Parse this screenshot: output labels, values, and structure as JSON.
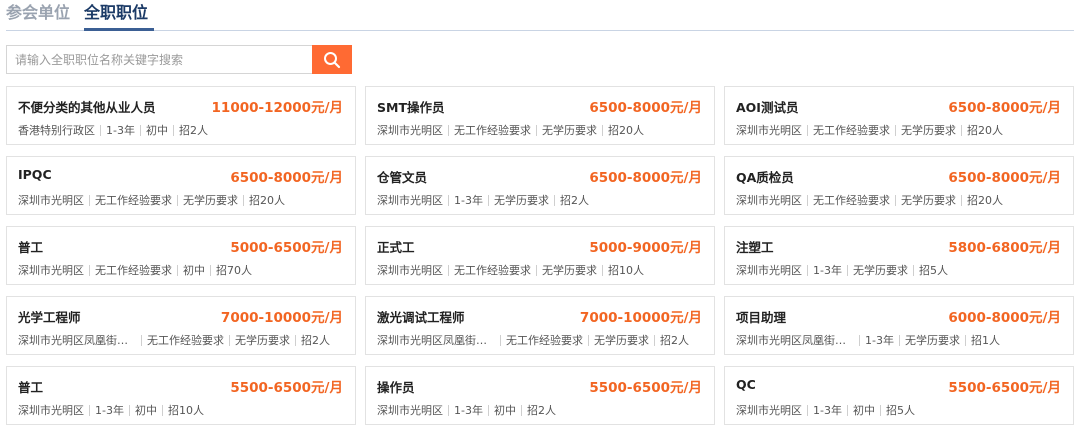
{
  "tabs": {
    "inactive": "参会单位",
    "active": "全职职位"
  },
  "search": {
    "placeholder": "请输入全职职位名称关键字搜索",
    "button_icon": "search-icon",
    "button_color": "#ff6a33"
  },
  "colors": {
    "salary": "#f26522",
    "accent": "#1b3a66"
  },
  "jobs": [
    {
      "title": "不便分类的其他从业人员",
      "salary": "11000-12000元/月",
      "location": "香港特别行政区",
      "experience": "1-3年",
      "education": "初中",
      "headcount": "招2人"
    },
    {
      "title": "SMT操作员",
      "salary": "6500-8000元/月",
      "location": "深圳市光明区",
      "experience": "无工作经验要求",
      "education": "无学历要求",
      "headcount": "招20人"
    },
    {
      "title": "AOI测试员",
      "salary": "6500-8000元/月",
      "location": "深圳市光明区",
      "experience": "无工作经验要求",
      "education": "无学历要求",
      "headcount": "招20人"
    },
    {
      "title": "IPQC",
      "salary": "6500-8000元/月",
      "location": "深圳市光明区",
      "experience": "无工作经验要求",
      "education": "无学历要求",
      "headcount": "招20人"
    },
    {
      "title": "仓管文员",
      "salary": "6500-8000元/月",
      "location": "深圳市光明区",
      "experience": "1-3年",
      "education": "无学历要求",
      "headcount": "招2人"
    },
    {
      "title": "QA质检员",
      "salary": "6500-8000元/月",
      "location": "深圳市光明区",
      "experience": "无工作经验要求",
      "education": "无学历要求",
      "headcount": "招20人"
    },
    {
      "title": "普工",
      "salary": "5000-6500元/月",
      "location": "深圳市光明区",
      "experience": "无工作经验要求",
      "education": "初中",
      "headcount": "招70人"
    },
    {
      "title": "正式工",
      "salary": "5000-9000元/月",
      "location": "深圳市光明区",
      "experience": "无工作经验要求",
      "education": "无学历要求",
      "headcount": "招10人"
    },
    {
      "title": "注塑工",
      "salary": "5800-6800元/月",
      "location": "深圳市光明区",
      "experience": "1-3年",
      "education": "无学历要求",
      "headcount": "招5人"
    },
    {
      "title": "光学工程师",
      "salary": "7000-10000元/月",
      "location": "深圳市光明区凤凰街道...",
      "experience": "无工作经验要求",
      "education": "无学历要求",
      "headcount": "招2人"
    },
    {
      "title": "激光调试工程师",
      "salary": "7000-10000元/月",
      "location": "深圳市光明区凤凰街道...",
      "experience": "无工作经验要求",
      "education": "无学历要求",
      "headcount": "招2人"
    },
    {
      "title": "项目助理",
      "salary": "6000-8000元/月",
      "location": "深圳市光明区凤凰街道...",
      "experience": "1-3年",
      "education": "无学历要求",
      "headcount": "招1人"
    },
    {
      "title": "普工",
      "salary": "5500-6500元/月",
      "location": "深圳市光明区",
      "experience": "1-3年",
      "education": "初中",
      "headcount": "招10人"
    },
    {
      "title": "操作员",
      "salary": "5500-6500元/月",
      "location": "深圳市光明区",
      "experience": "1-3年",
      "education": "初中",
      "headcount": "招2人"
    },
    {
      "title": "QC",
      "salary": "5500-6500元/月",
      "location": "深圳市光明区",
      "experience": "1-3年",
      "education": "初中",
      "headcount": "招5人"
    }
  ]
}
